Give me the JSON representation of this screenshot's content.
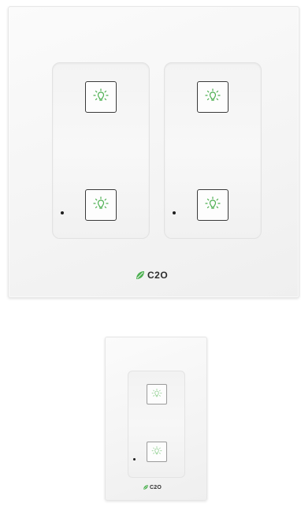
{
  "brand": {
    "name": "C2O",
    "accent_color": "#4caf50",
    "text_color": "#2e2e2e"
  },
  "large_plate": {
    "gangs": [
      {
        "buttons": [
          {
            "icon": "lightbulb-icon"
          },
          {
            "icon": "lightbulb-icon"
          }
        ],
        "has_indicator_led": true
      },
      {
        "buttons": [
          {
            "icon": "lightbulb-icon"
          },
          {
            "icon": "lightbulb-icon"
          }
        ],
        "has_indicator_led": true
      }
    ]
  },
  "small_plate": {
    "gangs": [
      {
        "buttons": [
          {
            "icon": "lightbulb-icon"
          },
          {
            "icon": "lightbulb-icon"
          }
        ],
        "has_indicator_led": true
      }
    ]
  }
}
